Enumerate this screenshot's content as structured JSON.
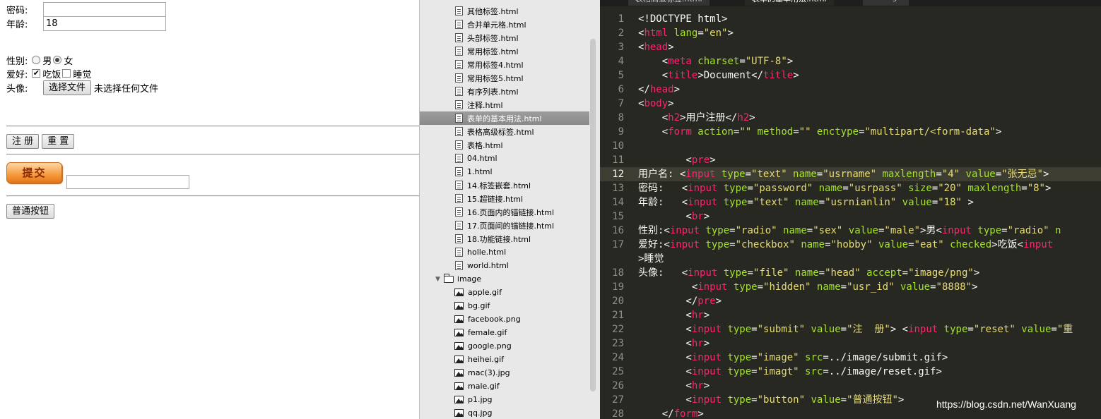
{
  "preview": {
    "password_label": "密码:",
    "age_label": "年龄:",
    "age_value": "18",
    "gender_label": "性别:",
    "gender_male": "男",
    "gender_female": "女",
    "hobby_label": "爱好:",
    "hobby_eat": "吃饭",
    "hobby_sleep": "睡觉",
    "avatar_label": "头像:",
    "choose_file_button": "选择文件",
    "no_file_text": "未选择任何文件",
    "register_button": "注 册",
    "reset_button": "重 置",
    "submit_image_button": "提交",
    "normal_button": "普通按钮"
  },
  "sidebar": {
    "files": [
      "其他标签.html",
      "合并单元格.html",
      "头部标签.html",
      "常用标签.html",
      "常用标签4.html",
      "常用标签5.html",
      "有序列表.html",
      "注释.html",
      "表单的基本用法.html",
      "表格高级标签.html",
      "表格.html",
      "04.html",
      "1.html",
      "14.标签嵌套.html",
      "15.超链接.html",
      "16.页面内的锚链接.html",
      "17.页面间的锚链接.html",
      "18.功能链接.html",
      "holle.html",
      "world.html"
    ],
    "selected_file": "表单的基本用法.html",
    "image_folder": "image",
    "images": [
      "apple.gif",
      "bg.gif",
      "facebook.png",
      "female.gif",
      "google.png",
      "heihei.gif",
      "mac(3).jpg",
      "male.gif",
      "p1.jpg",
      "qq.jpg"
    ]
  },
  "editor": {
    "tabs": [
      "表格高级标签.html",
      "表单的基本用法.html",
      "reset.gif"
    ],
    "current_line": "12",
    "lines": [
      {
        "n": "1",
        "segs": [
          {
            "c": "tx",
            "t": "<!DOCTYPE html>"
          }
        ]
      },
      {
        "n": "2",
        "segs": [
          {
            "c": "tx",
            "t": "<"
          },
          {
            "c": "tg",
            "t": "html"
          },
          {
            "c": "at",
            "t": " lang"
          },
          {
            "c": "tx",
            "t": "="
          },
          {
            "c": "st",
            "t": "\"en\""
          },
          {
            "c": "tx",
            "t": ">"
          }
        ]
      },
      {
        "n": "3",
        "segs": [
          {
            "c": "tx",
            "t": "<"
          },
          {
            "c": "tg",
            "t": "head"
          },
          {
            "c": "tx",
            "t": ">"
          }
        ]
      },
      {
        "n": "4",
        "segs": [
          {
            "c": "tx",
            "t": "    <"
          },
          {
            "c": "tg",
            "t": "meta"
          },
          {
            "c": "at",
            "t": " charset"
          },
          {
            "c": "tx",
            "t": "="
          },
          {
            "c": "st",
            "t": "\"UTF-8\""
          },
          {
            "c": "tx",
            "t": ">"
          }
        ]
      },
      {
        "n": "5",
        "segs": [
          {
            "c": "tx",
            "t": "    <"
          },
          {
            "c": "tg",
            "t": "title"
          },
          {
            "c": "tx",
            "t": ">Document</"
          },
          {
            "c": "tg",
            "t": "title"
          },
          {
            "c": "tx",
            "t": ">"
          }
        ]
      },
      {
        "n": "6",
        "segs": [
          {
            "c": "tx",
            "t": "</"
          },
          {
            "c": "tg",
            "t": "head"
          },
          {
            "c": "tx",
            "t": ">"
          }
        ]
      },
      {
        "n": "7",
        "segs": [
          {
            "c": "tx",
            "t": "<"
          },
          {
            "c": "tg",
            "t": "body"
          },
          {
            "c": "tx",
            "t": ">"
          }
        ]
      },
      {
        "n": "8",
        "segs": [
          {
            "c": "tx",
            "t": "    <"
          },
          {
            "c": "tg",
            "t": "h2"
          },
          {
            "c": "tx",
            "t": ">用户注册</"
          },
          {
            "c": "tg",
            "t": "h2"
          },
          {
            "c": "tx",
            "t": ">"
          }
        ]
      },
      {
        "n": "9",
        "segs": [
          {
            "c": "tx",
            "t": "    <"
          },
          {
            "c": "tg",
            "t": "form"
          },
          {
            "c": "at",
            "t": " action"
          },
          {
            "c": "tx",
            "t": "="
          },
          {
            "c": "st",
            "t": "\"\""
          },
          {
            "c": "at",
            "t": " method"
          },
          {
            "c": "tx",
            "t": "="
          },
          {
            "c": "st",
            "t": "\"\""
          },
          {
            "c": "at",
            "t": " enctype"
          },
          {
            "c": "tx",
            "t": "="
          },
          {
            "c": "st",
            "t": "\"multipart/<form-data\""
          },
          {
            "c": "tx",
            "t": ">"
          }
        ]
      },
      {
        "n": "10",
        "segs": []
      },
      {
        "n": "11",
        "segs": [
          {
            "c": "tx",
            "t": "        <"
          },
          {
            "c": "tg",
            "t": "pre"
          },
          {
            "c": "tx",
            "t": ">"
          }
        ]
      },
      {
        "n": "12",
        "segs": [
          {
            "c": "tx",
            "t": "用户名: <"
          },
          {
            "c": "tg",
            "t": "input"
          },
          {
            "c": "at",
            "t": " type"
          },
          {
            "c": "tx",
            "t": "="
          },
          {
            "c": "st",
            "t": "\"text\""
          },
          {
            "c": "at",
            "t": " name"
          },
          {
            "c": "tx",
            "t": "="
          },
          {
            "c": "st",
            "t": "\"usrname\""
          },
          {
            "c": "at",
            "t": " maxlength"
          },
          {
            "c": "tx",
            "t": "="
          },
          {
            "c": "st",
            "t": "\"4\""
          },
          {
            "c": "at",
            "t": " value"
          },
          {
            "c": "tx",
            "t": "="
          },
          {
            "c": "st",
            "t": "\"张无忌\""
          },
          {
            "c": "tx",
            "t": ">"
          }
        ]
      },
      {
        "n": "13",
        "segs": [
          {
            "c": "tx",
            "t": "密码:   <"
          },
          {
            "c": "tg",
            "t": "input"
          },
          {
            "c": "at",
            "t": " type"
          },
          {
            "c": "tx",
            "t": "="
          },
          {
            "c": "st",
            "t": "\"password\""
          },
          {
            "c": "at",
            "t": " name"
          },
          {
            "c": "tx",
            "t": "="
          },
          {
            "c": "st",
            "t": "\"usrpass\""
          },
          {
            "c": "at",
            "t": " size"
          },
          {
            "c": "tx",
            "t": "="
          },
          {
            "c": "st",
            "t": "\"20\""
          },
          {
            "c": "at",
            "t": " maxlength"
          },
          {
            "c": "tx",
            "t": "="
          },
          {
            "c": "st",
            "t": "\"8\""
          },
          {
            "c": "tx",
            "t": ">"
          }
        ]
      },
      {
        "n": "14",
        "segs": [
          {
            "c": "tx",
            "t": "年龄:   <"
          },
          {
            "c": "tg",
            "t": "input"
          },
          {
            "c": "at",
            "t": " type"
          },
          {
            "c": "tx",
            "t": "="
          },
          {
            "c": "st",
            "t": "\"text\""
          },
          {
            "c": "at",
            "t": " name"
          },
          {
            "c": "tx",
            "t": "="
          },
          {
            "c": "st",
            "t": "\"usrnianlin\""
          },
          {
            "c": "at",
            "t": " value"
          },
          {
            "c": "tx",
            "t": "="
          },
          {
            "c": "st",
            "t": "\"18\""
          },
          {
            "c": "tx",
            "t": " >"
          }
        ]
      },
      {
        "n": "15",
        "segs": [
          {
            "c": "tx",
            "t": "        <"
          },
          {
            "c": "tg",
            "t": "br"
          },
          {
            "c": "tx",
            "t": ">"
          }
        ]
      },
      {
        "n": "16",
        "segs": [
          {
            "c": "tx",
            "t": "性别:<"
          },
          {
            "c": "tg",
            "t": "input"
          },
          {
            "c": "at",
            "t": " type"
          },
          {
            "c": "tx",
            "t": "="
          },
          {
            "c": "st",
            "t": "\"radio\""
          },
          {
            "c": "at",
            "t": " name"
          },
          {
            "c": "tx",
            "t": "="
          },
          {
            "c": "st",
            "t": "\"sex\""
          },
          {
            "c": "at",
            "t": " value"
          },
          {
            "c": "tx",
            "t": "="
          },
          {
            "c": "st",
            "t": "\"male\""
          },
          {
            "c": "tx",
            "t": ">男<"
          },
          {
            "c": "tg",
            "t": "input"
          },
          {
            "c": "at",
            "t": " type"
          },
          {
            "c": "tx",
            "t": "="
          },
          {
            "c": "st",
            "t": "\"radio\""
          },
          {
            "c": "at",
            "t": " n"
          }
        ]
      },
      {
        "n": "17",
        "segs": [
          {
            "c": "tx",
            "t": "爱好:<"
          },
          {
            "c": "tg",
            "t": "input"
          },
          {
            "c": "at",
            "t": " type"
          },
          {
            "c": "tx",
            "t": "="
          },
          {
            "c": "st",
            "t": "\"checkbox\""
          },
          {
            "c": "at",
            "t": " name"
          },
          {
            "c": "tx",
            "t": "="
          },
          {
            "c": "st",
            "t": "\"hobby\""
          },
          {
            "c": "at",
            "t": " value"
          },
          {
            "c": "tx",
            "t": "="
          },
          {
            "c": "st",
            "t": "\"eat\""
          },
          {
            "c": "at",
            "t": " checked"
          },
          {
            "c": "tx",
            "t": ">吃饭<"
          },
          {
            "c": "tg",
            "t": "input"
          }
        ]
      },
      {
        "n": "",
        "segs": [
          {
            "c": "tx",
            "t": ">睡觉"
          }
        ]
      },
      {
        "n": "18",
        "segs": [
          {
            "c": "tx",
            "t": "头像:   <"
          },
          {
            "c": "tg",
            "t": "input"
          },
          {
            "c": "at",
            "t": " type"
          },
          {
            "c": "tx",
            "t": "="
          },
          {
            "c": "st",
            "t": "\"file\""
          },
          {
            "c": "at",
            "t": " name"
          },
          {
            "c": "tx",
            "t": "="
          },
          {
            "c": "st",
            "t": "\"head\""
          },
          {
            "c": "at",
            "t": " accept"
          },
          {
            "c": "tx",
            "t": "="
          },
          {
            "c": "st",
            "t": "\"image/png\""
          },
          {
            "c": "tx",
            "t": ">"
          }
        ]
      },
      {
        "n": "19",
        "segs": [
          {
            "c": "tx",
            "t": "         <"
          },
          {
            "c": "tg",
            "t": "input"
          },
          {
            "c": "at",
            "t": " type"
          },
          {
            "c": "tx",
            "t": "="
          },
          {
            "c": "st",
            "t": "\"hidden\""
          },
          {
            "c": "at",
            "t": " name"
          },
          {
            "c": "tx",
            "t": "="
          },
          {
            "c": "st",
            "t": "\"usr_id\""
          },
          {
            "c": "at",
            "t": " value"
          },
          {
            "c": "tx",
            "t": "="
          },
          {
            "c": "st",
            "t": "\"8888\""
          },
          {
            "c": "tx",
            "t": ">"
          }
        ]
      },
      {
        "n": "20",
        "segs": [
          {
            "c": "tx",
            "t": "        </"
          },
          {
            "c": "tg",
            "t": "pre"
          },
          {
            "c": "tx",
            "t": ">"
          }
        ]
      },
      {
        "n": "21",
        "segs": [
          {
            "c": "tx",
            "t": "        <"
          },
          {
            "c": "tg",
            "t": "hr"
          },
          {
            "c": "tx",
            "t": ">"
          }
        ]
      },
      {
        "n": "22",
        "segs": [
          {
            "c": "tx",
            "t": "        <"
          },
          {
            "c": "tg",
            "t": "input"
          },
          {
            "c": "at",
            "t": " type"
          },
          {
            "c": "tx",
            "t": "="
          },
          {
            "c": "st",
            "t": "\"submit\""
          },
          {
            "c": "at",
            "t": " value"
          },
          {
            "c": "tx",
            "t": "="
          },
          {
            "c": "st",
            "t": "\"注  册\""
          },
          {
            "c": "tx",
            "t": "> <"
          },
          {
            "c": "tg",
            "t": "input"
          },
          {
            "c": "at",
            "t": " type"
          },
          {
            "c": "tx",
            "t": "="
          },
          {
            "c": "st",
            "t": "\"reset\""
          },
          {
            "c": "at",
            "t": " value"
          },
          {
            "c": "tx",
            "t": "="
          },
          {
            "c": "st",
            "t": "\"重"
          }
        ]
      },
      {
        "n": "23",
        "segs": [
          {
            "c": "tx",
            "t": "        <"
          },
          {
            "c": "tg",
            "t": "hr"
          },
          {
            "c": "tx",
            "t": ">"
          }
        ]
      },
      {
        "n": "24",
        "segs": [
          {
            "c": "tx",
            "t": "        <"
          },
          {
            "c": "tg",
            "t": "input"
          },
          {
            "c": "at",
            "t": " type"
          },
          {
            "c": "tx",
            "t": "="
          },
          {
            "c": "st",
            "t": "\"image\""
          },
          {
            "c": "at",
            "t": " src"
          },
          {
            "c": "tx",
            "t": "=../image/submit.gif>"
          }
        ]
      },
      {
        "n": "25",
        "segs": [
          {
            "c": "tx",
            "t": "        <"
          },
          {
            "c": "tg",
            "t": "input"
          },
          {
            "c": "at",
            "t": " type"
          },
          {
            "c": "tx",
            "t": "="
          },
          {
            "c": "st",
            "t": "\"imagt\""
          },
          {
            "c": "at",
            "t": " src"
          },
          {
            "c": "tx",
            "t": "=../image/reset.gif>"
          }
        ]
      },
      {
        "n": "26",
        "segs": [
          {
            "c": "tx",
            "t": "        <"
          },
          {
            "c": "tg",
            "t": "hr"
          },
          {
            "c": "tx",
            "t": ">"
          }
        ]
      },
      {
        "n": "27",
        "segs": [
          {
            "c": "tx",
            "t": "        <"
          },
          {
            "c": "tg",
            "t": "input"
          },
          {
            "c": "at",
            "t": " type"
          },
          {
            "c": "tx",
            "t": "="
          },
          {
            "c": "st",
            "t": "\"button\""
          },
          {
            "c": "at",
            "t": " value"
          },
          {
            "c": "tx",
            "t": "="
          },
          {
            "c": "st",
            "t": "\"普通按钮\""
          },
          {
            "c": "tx",
            "t": ">"
          }
        ]
      },
      {
        "n": "28",
        "segs": [
          {
            "c": "tx",
            "t": "    </"
          },
          {
            "c": "tg",
            "t": "form"
          },
          {
            "c": "tx",
            "t": ">"
          }
        ]
      }
    ]
  },
  "watermark": "https://blog.csdn.net/WanXuang",
  "colors": {
    "editor_bg": "#272822",
    "tag": "#f92672",
    "attribute": "#a6e22e",
    "string": "#e6db74",
    "text": "#f8f8f2",
    "line_number": "#90908a",
    "sidebar_bg": "#e8e8e8",
    "submit_orange": "#f59a3c"
  }
}
